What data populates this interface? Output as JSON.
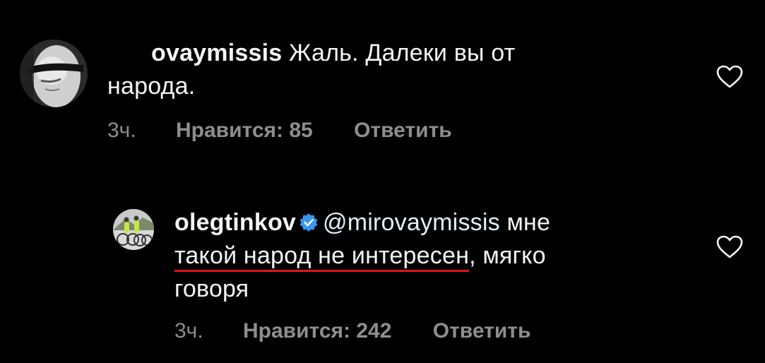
{
  "comments": [
    {
      "username": "ovaymissis",
      "text": "Жаль. Далеки вы от",
      "text_line2": "народа.",
      "time": "3ч.",
      "likes": "Нравится: 85",
      "reply": "Ответить"
    },
    {
      "username": "olegtinkov",
      "verified": true,
      "mention": "@mirovaymissis",
      "text_after_mention": " мне",
      "underlined_text": "такой народ не интересен",
      "text_after_underline": ", мягко",
      "text_line3": "говоря",
      "time": "3ч.",
      "likes": "Нравится: 242",
      "reply": "Ответить"
    }
  ],
  "colors": {
    "background": "#000000",
    "text": "#f5f5f5",
    "secondary": "#8e8e8e",
    "verified_badge": "#3897f0",
    "underline": "#e0141e"
  },
  "icons": [
    "heart-icon",
    "verified-badge-icon"
  ]
}
